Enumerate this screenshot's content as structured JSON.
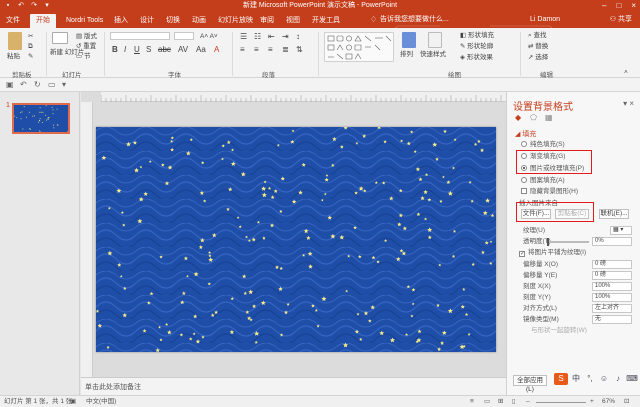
{
  "window": {
    "title": "新建 Microsoft PowerPoint 演示文稿 - PowerPoint",
    "controls": [
      "–",
      "□",
      "×"
    ]
  },
  "tabs": [
    {
      "label": "文件",
      "active": false
    },
    {
      "label": "开始",
      "active": true
    },
    {
      "label": "Nordri Tools",
      "active": false
    },
    {
      "label": "插入",
      "active": false
    },
    {
      "label": "设计",
      "active": false
    },
    {
      "label": "切换",
      "active": false
    },
    {
      "label": "动画",
      "active": false
    },
    {
      "label": "幻灯片放映",
      "active": false
    },
    {
      "label": "审阅",
      "active": false
    },
    {
      "label": "视图",
      "active": false
    },
    {
      "label": "开发工具",
      "active": false
    }
  ],
  "tell_me": "告诉我您想要做什么...",
  "user": "Li Damon",
  "share": "共享",
  "ribbon": {
    "paste": "粘贴",
    "new_slide": "新建\n幻灯片",
    "layout": "版式",
    "reset": "重置",
    "section": "节",
    "groups": {
      "clipboard": "剪贴板",
      "slides": "幻灯片",
      "font": "字体",
      "paragraph": "段落",
      "drawing": "绘图",
      "editing": "编辑"
    },
    "arrange": "排列",
    "quick_styles": "快速样式",
    "shape_fill": "形状填充",
    "shape_outline": "形状轮廓",
    "shape_effects": "形状效果",
    "find": "查找",
    "replace": "替换",
    "select": "选择"
  },
  "slides_pane": {
    "slide_number": "1"
  },
  "notes_placeholder": "单击此处添加备注",
  "format_pane": {
    "title": "设置背景格式",
    "section_fill": "填充",
    "options": {
      "solid": "纯色填充(S)",
      "gradient": "渐变填充(G)",
      "picture": "图片或纹理填充(P)",
      "pattern": "图案填充(A)",
      "hide_bg": "隐藏背景图形(H)"
    },
    "insert_from": "插入图片来自",
    "file_btn": "文件(F)...",
    "clipboard_btn": "剪贴板(C)",
    "online_btn": "联机(E)...",
    "texture_label": "纹理(U)",
    "transparency_label": "透明度(T)",
    "transparency_value": "0%",
    "tile_checkbox": "将图片平铺为纹理(I)",
    "offset_x_label": "偏移量 X(O)",
    "offset_x": "0 磅",
    "offset_y_label": "偏移量 Y(E)",
    "offset_y": "0 磅",
    "scale_x_label": "刻度 X(X)",
    "scale_x": "100%",
    "scale_y_label": "刻度 Y(Y)",
    "scale_y": "100%",
    "align_label": "对齐方式(L)",
    "align": "左上对齐",
    "mirror_label": "镜像类型(M)",
    "mirror": "无",
    "rotate_with_shape": "与形状一起旋转(W)",
    "reset_bg": "全部应用(L)"
  },
  "status": {
    "slide_info": "幻灯片 第 1 张，共 1 张",
    "language": "中文(中国)",
    "zoom": "67%"
  },
  "colors": {
    "accent": "#c43e1c",
    "slide_bg": "#1f4ea8",
    "highlight_box": "#e21b1b"
  }
}
